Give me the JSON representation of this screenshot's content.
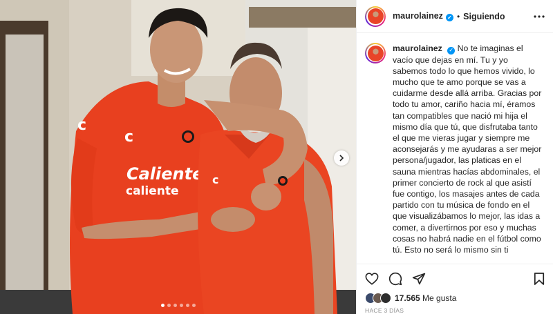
{
  "post": {
    "username": "maurolainez",
    "follow_status": "Siguiendo",
    "separator": "•",
    "caption": "No te imaginas el vacío que dejas en mí. Tu y yo sabemos todo lo que hemos vivido, lo mucho que te amo porque se vas a cuidarme desde allá arriba. Gracias por todo tu amor, cariño hacia mí, éramos tan compatibles que nació mi hija el mismo día que tú, que disfrutaba tanto el que me vieras jugar y siempre me aconsejarás y me ayudaras a ser mejor persona/jugador, las platicas en el sauna mientras hacías abdominales, el primer concierto de rock al que asistí fue contigo, los masajes antes de cada partido con tu música de fondo en el que visualizábamos lo mejor, las idas a comer, a divertirnos por eso y muchas cosas no habrá nadie en el fútbol como tú. Esto no será lo mismo sin ti",
    "likes_count": "17.565",
    "likes_label": "Me gusta",
    "time_ago": "HACE 3 DÍAS"
  },
  "photo": {
    "jersey_sponsor_line1": "Caliente",
    "jersey_sponsor_line2": "caliente",
    "carousel_dots": 6,
    "active_dot": 1
  },
  "icons": {
    "more": "more-horizontal-icon",
    "like": "heart-icon",
    "comment": "comment-icon",
    "share": "paper-plane-icon",
    "save": "bookmark-icon",
    "next": "chevron-right-icon",
    "verified": "verified-badge-icon"
  },
  "colors": {
    "verified_blue": "#0095f6",
    "jersey_red": "#e8401f",
    "muted_text": "#8e8e8e"
  }
}
